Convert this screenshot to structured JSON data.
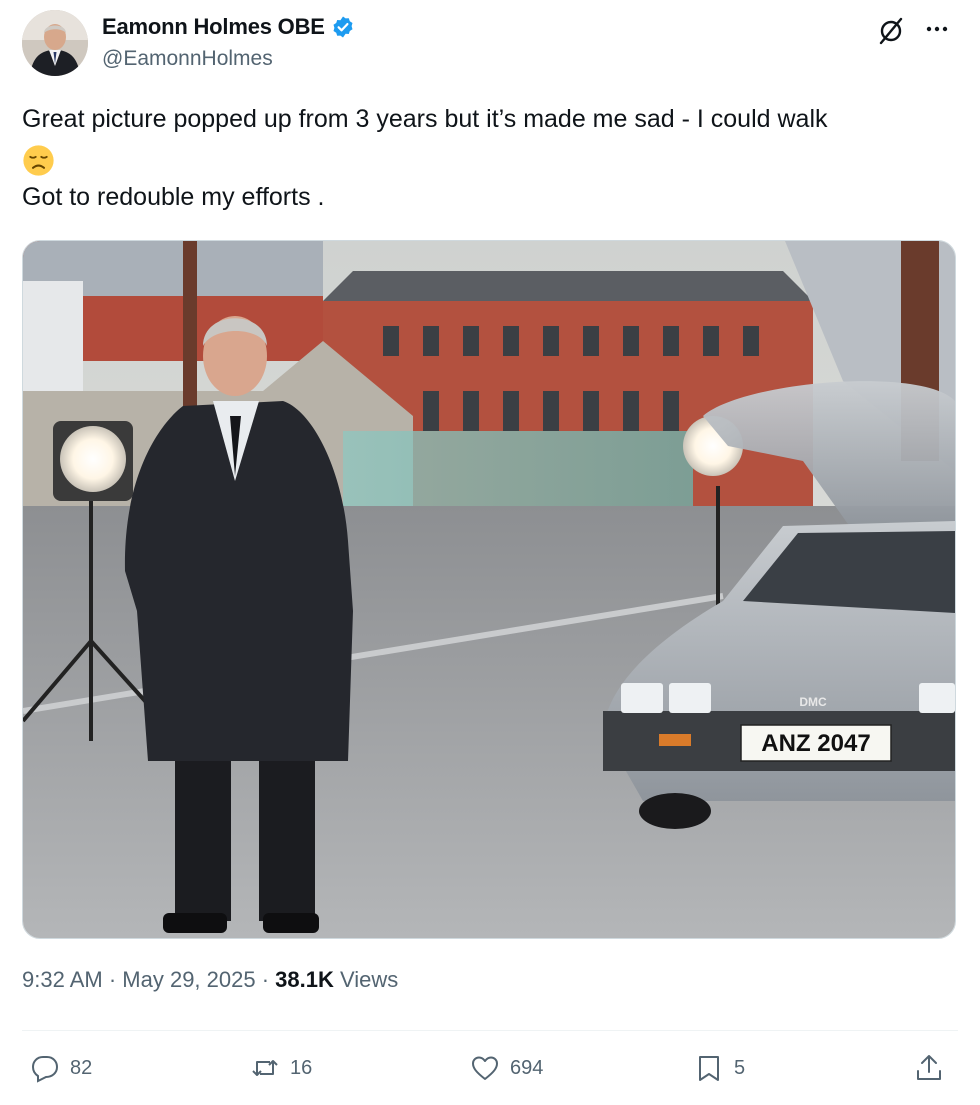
{
  "author": {
    "display_name": "Eamonn Holmes OBE",
    "handle": "@EamonnHolmes",
    "verified": true,
    "verified_color": "#1d9bf0"
  },
  "tweet": {
    "line1": "Great picture popped up from 3 years but it’s made me sad - I could walk",
    "emoji": "disappointed-face-emoji",
    "line2": "Got to redouble my efforts ."
  },
  "media": {
    "license_plate": "ANZ 2047",
    "car_badge": "DMC"
  },
  "meta": {
    "time": "9:32 AM",
    "separator1": " · ",
    "date": "May 29, 2025",
    "separator2": " · ",
    "views_count": "38.1K",
    "views_label": " Views"
  },
  "actions": {
    "replies": "82",
    "reposts": "16",
    "likes": "694",
    "bookmarks": "5"
  },
  "icons": {
    "grok": "grok-icon",
    "more": "more-icon",
    "reply": "reply-icon",
    "repost": "repost-icon",
    "like": "heart-icon",
    "bookmark": "bookmark-icon",
    "share": "share-icon"
  },
  "colors": {
    "text": "#0f1419",
    "secondary": "#536471",
    "divider": "#eff3f4"
  }
}
